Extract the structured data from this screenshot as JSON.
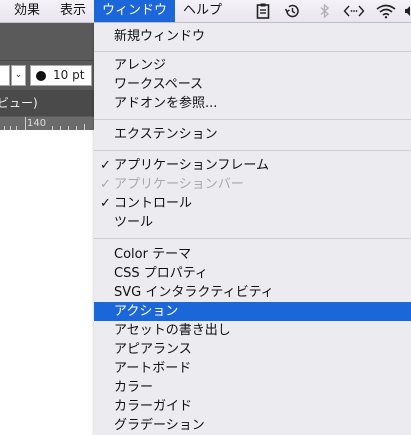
{
  "menubar": {
    "items": [
      "効果",
      "表示",
      "ウィンドウ",
      "ヘルプ"
    ],
    "active_index": 2
  },
  "app": {
    "stroke_weight": "10 pt",
    "doc_tab": "ビュー)",
    "ruler_label": "140"
  },
  "menu": {
    "groups": [
      [
        "新規ウィンドウ"
      ],
      [
        "アレンジ",
        "ワークスペース",
        "アドオンを参照..."
      ],
      [
        "エクステンション"
      ],
      [
        "アプリケーションフレーム",
        "アプリケーションバー",
        "コントロール",
        "ツール"
      ],
      [
        "Color テーマ",
        "CSS プロパティ",
        "SVG インタラクティビティ",
        "アクション",
        "アセットの書き出し",
        "アピアランス",
        "アートボード",
        "カラー",
        "カラーガイド",
        "グラデーション"
      ]
    ],
    "checked": [
      "アプリケーションフレーム",
      "アプリケーションバー",
      "コントロール"
    ],
    "disabled": [
      "アプリケーションバー"
    ],
    "highlighted": "アクション"
  },
  "colors": {
    "highlight": "#1b66d9",
    "menu_bg": "#ecebf0",
    "app_chrome": "#5a5a5a"
  }
}
